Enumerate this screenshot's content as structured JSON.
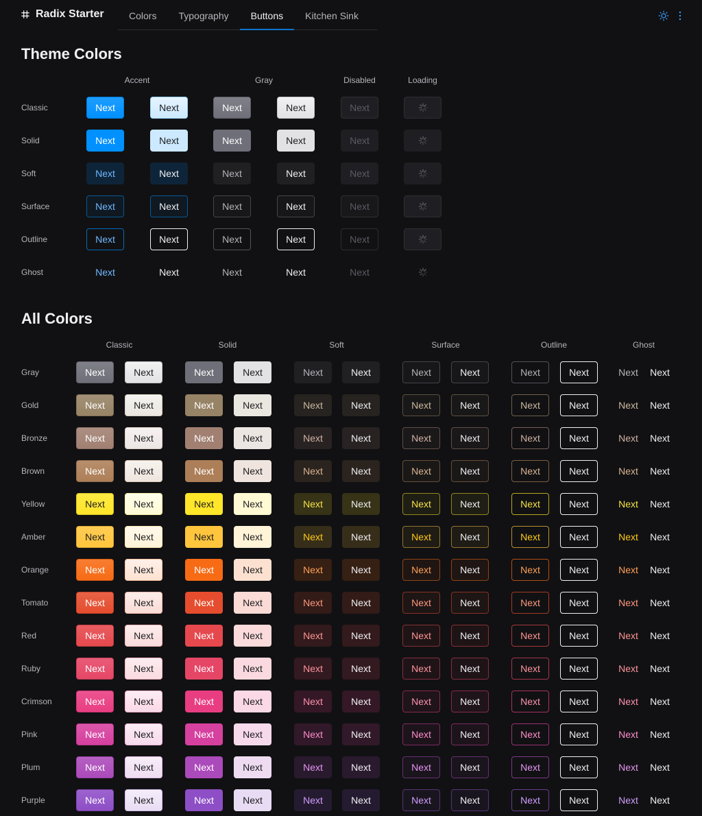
{
  "header": {
    "app_title": "Radix Starter",
    "logo_icon": "hash-icon",
    "tabs": [
      {
        "label": "Colors",
        "active": false
      },
      {
        "label": "Typography",
        "active": false
      },
      {
        "label": "Buttons",
        "active": true
      },
      {
        "label": "Kitchen Sink",
        "active": false
      }
    ],
    "theme_toggle_icon": "sun-icon",
    "menu_icon": "dots-vertical-icon",
    "accent_color": "#0d74ce"
  },
  "theme_colors": {
    "title": "Theme Colors",
    "columns": [
      "Accent",
      "Gray",
      "Disabled",
      "Loading"
    ],
    "button_label": "Next",
    "rows": [
      "Classic",
      "Solid",
      "Soft",
      "Surface",
      "Outline",
      "Ghost"
    ]
  },
  "all_colors": {
    "title": "All Colors",
    "columns": [
      "Classic",
      "Solid",
      "Soft",
      "Surface",
      "Outline",
      "Ghost"
    ],
    "button_label": "Next",
    "colors": [
      {
        "name": "Gray",
        "hex": "#6e6f78",
        "light": "#b4b4bb"
      },
      {
        "name": "Gold",
        "hex": "#978365",
        "light": "#cbb99f"
      },
      {
        "name": "Bronze",
        "hex": "#a18072",
        "light": "#d4b3a5"
      },
      {
        "name": "Brown",
        "hex": "#ad7f58",
        "light": "#dbb594"
      },
      {
        "name": "Yellow",
        "hex": "#ffe629",
        "light": "#f5e147"
      },
      {
        "name": "Amber",
        "hex": "#ffc53d",
        "light": "#ffca16"
      },
      {
        "name": "Orange",
        "hex": "#f76b15",
        "light": "#ffa057"
      },
      {
        "name": "Tomato",
        "hex": "#e54d2e",
        "light": "#ff977d"
      },
      {
        "name": "Red",
        "hex": "#e5484d",
        "light": "#ff9592"
      },
      {
        "name": "Ruby",
        "hex": "#e54666",
        "light": "#ff949d"
      },
      {
        "name": "Crimson",
        "hex": "#e93d82",
        "light": "#ff92ad"
      },
      {
        "name": "Pink",
        "hex": "#d6409f",
        "light": "#ff8dcc"
      },
      {
        "name": "Plum",
        "hex": "#ab4aba",
        "light": "#e796f3"
      },
      {
        "name": "Purple",
        "hex": "#8e4ec6",
        "light": "#d19dff"
      }
    ]
  }
}
